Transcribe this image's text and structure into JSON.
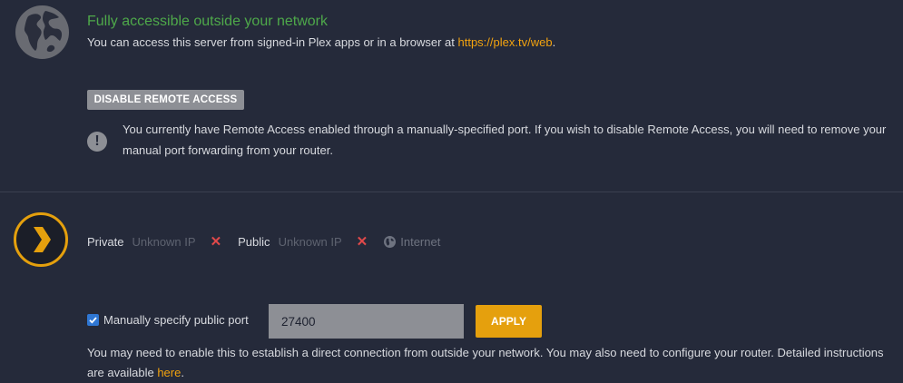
{
  "remote_status": {
    "title": "Fully accessible outside your network",
    "description": "You can access this server from signed-in Plex apps or in a browser at ",
    "link_text": "https://plex.tv/web",
    "description_end": ".",
    "status_color": "#4ea84a"
  },
  "disable_button": {
    "label": "DISABLE REMOTE ACCESS"
  },
  "warning": {
    "icon": "exclamation-icon",
    "text": "You currently have Remote Access enabled through a manually-specified port. If you wish to disable Remote Access, you will need to remove your manual port forwarding from your router."
  },
  "connection": {
    "private_label": "Private",
    "private_value": "Unknown IP",
    "public_label": "Public",
    "public_value": "Unknown IP",
    "internet_label": "Internet"
  },
  "manual_port": {
    "checkbox_label": "Manually specify public port",
    "checked": true,
    "value": "27400",
    "apply_label": "APPLY",
    "help_text": "You may need to enable this to establish a direct connection from outside your network. You may also need to configure your router. Detailed instructions are available ",
    "help_link": "here",
    "help_end": "."
  },
  "colors": {
    "background": "#252a3a",
    "accent": "#e5a00d",
    "link": "#f3a30f",
    "error": "#e0494a"
  }
}
